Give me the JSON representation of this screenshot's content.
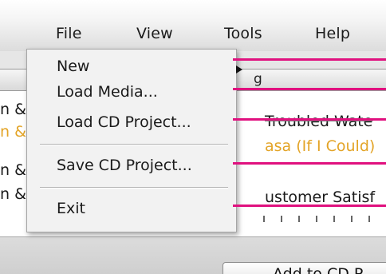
{
  "menubar": {
    "file": "File",
    "view": "View",
    "tools": "Tools",
    "help": "Help"
  },
  "column_header": {
    "fragment": "g"
  },
  "tracklist": {
    "rows": [
      {
        "left": "n &",
        "right": "Troubled Wate",
        "highlight": false
      },
      {
        "left": "n &",
        "right": "asa (If I Could)",
        "highlight": true
      },
      {
        "left": "n &",
        "right": "",
        "highlight": false
      },
      {
        "left": "n &",
        "right": "ustomer Satisf",
        "highlight": false
      }
    ]
  },
  "file_menu": {
    "items": [
      {
        "label": "New",
        "has_submenu": true
      },
      {
        "label": "Load Media..."
      },
      {
        "label": "Load CD Project..."
      },
      {
        "label": "Save CD Project..."
      },
      {
        "label": "Exit"
      }
    ]
  },
  "bottom_bar": {
    "add_button": "Add to CD P"
  },
  "colors": {
    "callout": "#e0117f",
    "highlight_text": "#e3a427",
    "menu_bg": "#f2f2f2"
  }
}
